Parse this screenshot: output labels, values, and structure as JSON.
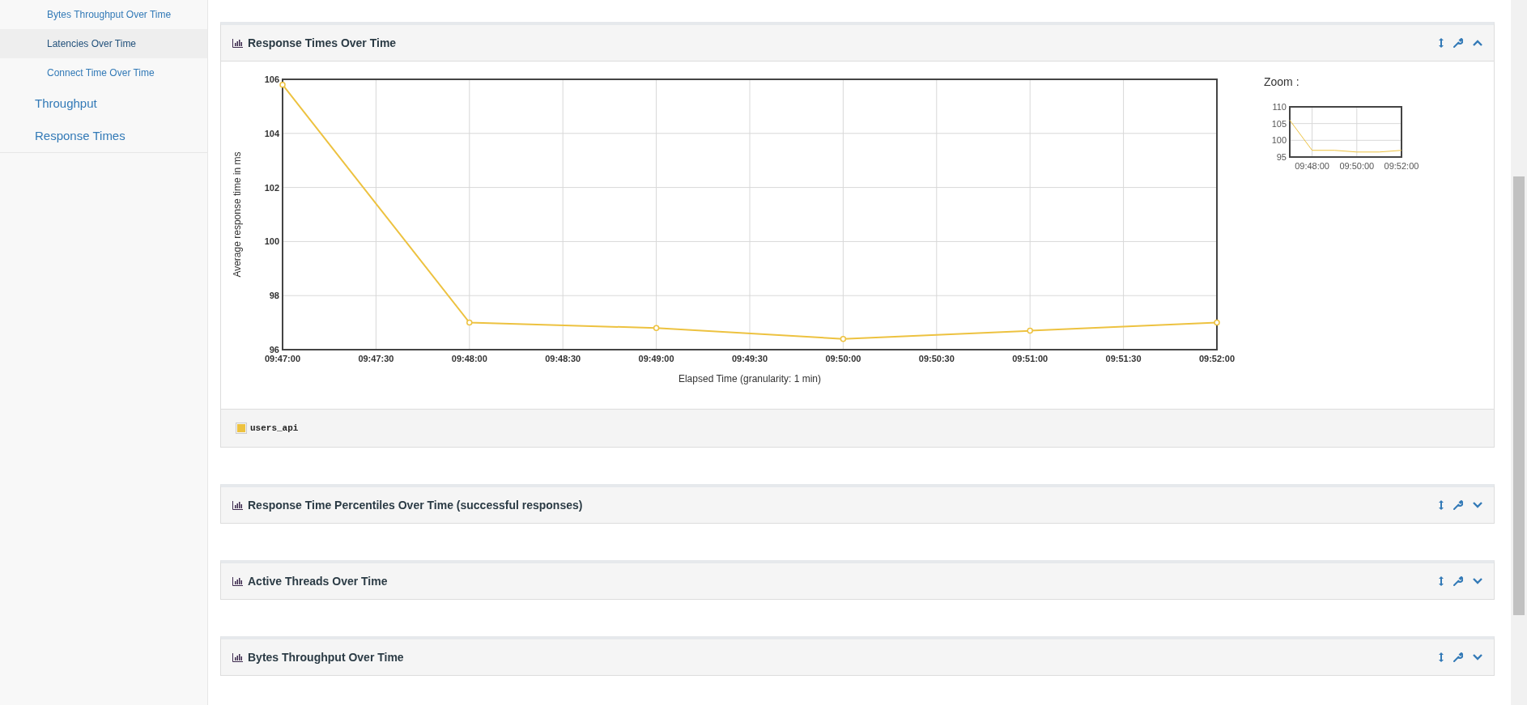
{
  "sidebar": {
    "items": [
      {
        "label": "Bytes Throughput Over Time",
        "kind": "subitem",
        "selected": false
      },
      {
        "label": "Latencies Over Time",
        "kind": "subitem",
        "selected": true
      },
      {
        "label": "Connect Time Over Time",
        "kind": "subitem",
        "selected": false
      },
      {
        "label": "Throughput",
        "kind": "item",
        "selected": false
      },
      {
        "label": "Response Times",
        "kind": "item",
        "selected": false
      }
    ]
  },
  "panels": [
    {
      "title": "Response Times Over Time",
      "expanded": true,
      "chart_data": {
        "type": "line",
        "grid": true,
        "xlabel": "Elapsed Time (granularity: 1 min)",
        "ylabel": "Average response time in ms",
        "x": [
          35220,
          35280,
          35340,
          35400,
          35460,
          35520
        ],
        "series": [
          {
            "name": "users_api",
            "color": "#edc240",
            "marker": "circle",
            "values": [
              105.8,
              97.0,
              96.8,
              96.4,
              96.7,
              97.0
            ]
          }
        ],
        "xlim": [
          35220,
          35520
        ],
        "ylim": [
          96,
          106
        ],
        "xticks": [
          {
            "value": 35220,
            "label": "09:47:00"
          },
          {
            "value": 35250,
            "label": "09:47:30"
          },
          {
            "value": 35280,
            "label": "09:48:00"
          },
          {
            "value": 35310,
            "label": "09:48:30"
          },
          {
            "value": 35340,
            "label": "09:49:00"
          },
          {
            "value": 35370,
            "label": "09:49:30"
          },
          {
            "value": 35400,
            "label": "09:50:00"
          },
          {
            "value": 35430,
            "label": "09:50:30"
          },
          {
            "value": 35460,
            "label": "09:51:00"
          },
          {
            "value": 35490,
            "label": "09:51:30"
          },
          {
            "value": 35520,
            "label": "09:52:00"
          }
        ],
        "yticks": [
          96,
          98,
          100,
          102,
          104,
          106
        ]
      },
      "zoom": {
        "label": "Zoom :",
        "chart_data": {
          "type": "line",
          "grid": true,
          "x": [
            35220,
            35280,
            35340,
            35400,
            35460,
            35520
          ],
          "series": [
            {
              "color": "#edc240",
              "values": [
                106,
                97,
                97,
                96.5,
                96.5,
                97
              ]
            }
          ],
          "xlim": [
            35220,
            35520
          ],
          "ylim": [
            95,
            110
          ],
          "xticks": [
            {
              "value": 35280,
              "label": "09:48:00"
            },
            {
              "value": 35400,
              "label": "09:50:00"
            },
            {
              "value": 35520,
              "label": "09:52:00"
            }
          ],
          "yticks": [
            95,
            100,
            105,
            110
          ]
        }
      }
    },
    {
      "title": "Response Time Percentiles Over Time (successful responses)",
      "expanded": false
    },
    {
      "title": "Active Threads Over Time",
      "expanded": false
    },
    {
      "title": "Bytes Throughput Over Time",
      "expanded": false
    }
  ]
}
